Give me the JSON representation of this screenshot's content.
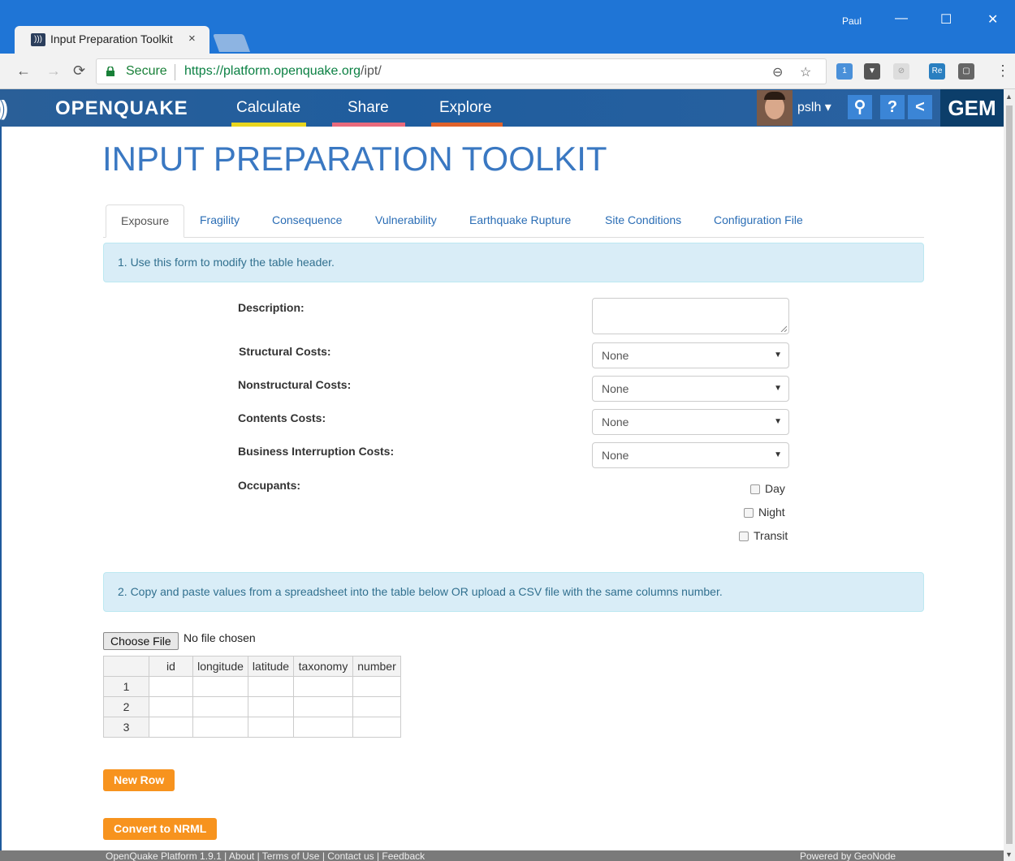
{
  "browser": {
    "tab_title": "Input Preparation Toolkit",
    "tab_close": "×",
    "window_user": "Paul",
    "url_secure_label": "Secure",
    "url_host": "https://platform.openquake.org",
    "url_path": "/ipt/",
    "ext_badge": "1",
    "ext_re": "Re"
  },
  "site": {
    "logo": "OPENQUAKE",
    "nav": [
      "Calculate",
      "Share",
      "Explore"
    ],
    "nav_colors": [
      "#e8d51e",
      "#e96a7c",
      "#e0622b"
    ],
    "user": "pslh ▾",
    "gem": "GEM",
    "help": "?"
  },
  "page": {
    "title": "INPUT PREPARATION TOOLKIT",
    "tabs": [
      "Exposure",
      "Fragility",
      "Consequence",
      "Vulnerability",
      "Earthquake Rupture",
      "Site Conditions",
      "Configuration File"
    ],
    "info1": "1. Use this form to modify the table header.",
    "info2": "2. Copy and paste values from a spreadsheet into the table below OR upload a CSV file with the same columns number.",
    "form": {
      "description_label": "Description:",
      "structural_label": "Structural Costs:",
      "nonstructural_label": "Nonstructural Costs:",
      "contents_label": "Contents Costs:",
      "business_label": "Business Interruption Costs:",
      "occupants_label": "Occupants:",
      "select_value": "None",
      "occupants": [
        "Day",
        "Night",
        "Transit"
      ]
    },
    "file": {
      "button": "Choose File",
      "status": "No file chosen"
    },
    "table": {
      "columns": [
        "id",
        "longitude",
        "latitude",
        "taxonomy",
        "number"
      ],
      "rows": [
        "1",
        "2",
        "3"
      ]
    },
    "new_row": "New Row",
    "convert": "Convert to NRML",
    "footer_left": "OpenQuake Platform 1.9.1 | About | Terms of Use | Contact us | Feedback",
    "footer_right": "Powered by GeoNode"
  }
}
